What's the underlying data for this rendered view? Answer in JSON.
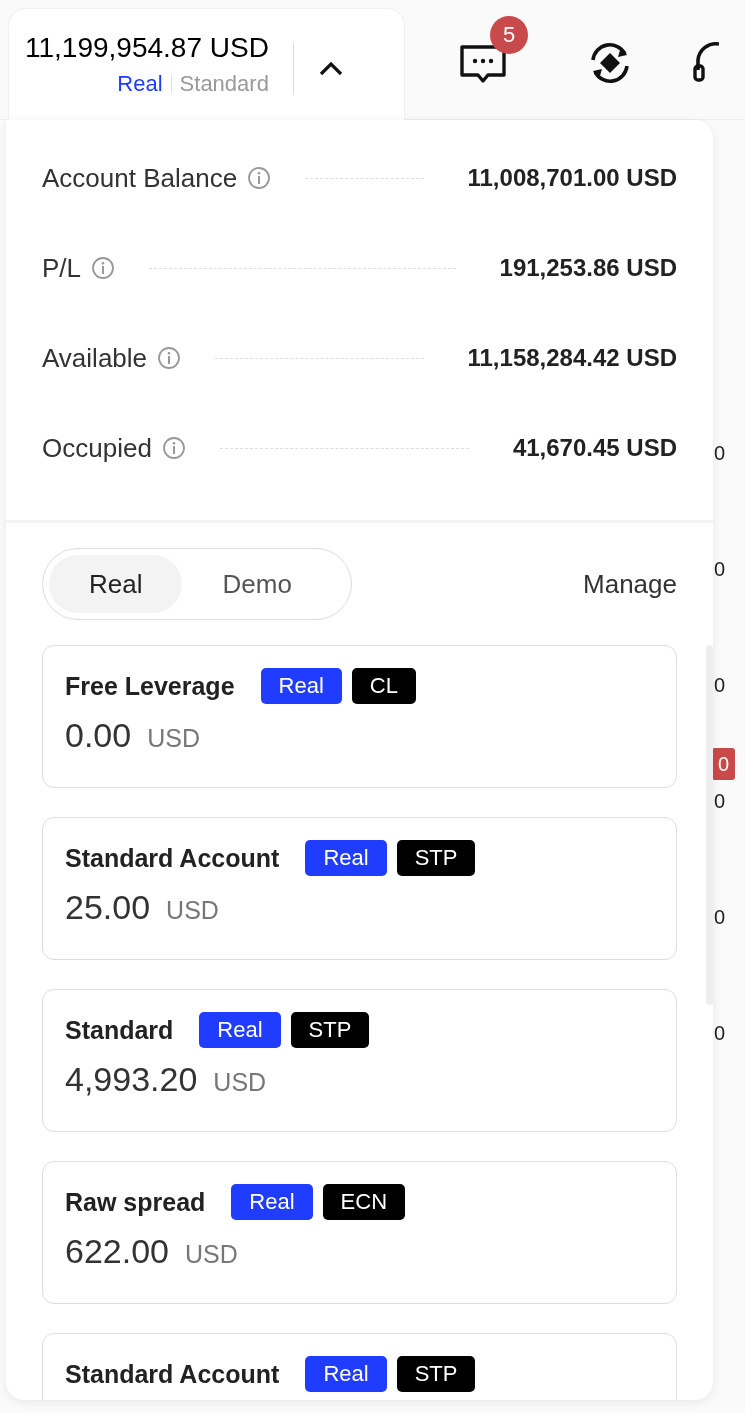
{
  "header": {
    "balance": "11,199,954.87 USD",
    "account_type": "Real",
    "account_name": "Standard",
    "expanded": true
  },
  "notifications": {
    "count": "5"
  },
  "summary": [
    {
      "label": "Account Balance",
      "value": "11,008,701.00 USD"
    },
    {
      "label": "P/L",
      "value": "191,253.86 USD"
    },
    {
      "label": "Available",
      "value": "11,158,284.42 USD"
    },
    {
      "label": "Occupied",
      "value": "41,670.45 USD"
    }
  ],
  "account_tabs": [
    {
      "label": "Real",
      "selected": true
    },
    {
      "label": "Demo",
      "selected": false
    }
  ],
  "manage": "Manage",
  "accounts": [
    {
      "name": "Free Leverage",
      "tags": [
        {
          "label": "Real",
          "kind": "mode"
        },
        {
          "label": "CL",
          "kind": "type"
        }
      ],
      "amount": "0.00",
      "currency": "USD"
    },
    {
      "name": "Standard Account",
      "tags": [
        {
          "label": "Real",
          "kind": "mode"
        },
        {
          "label": "STP",
          "kind": "type"
        }
      ],
      "amount": "25.00",
      "currency": "USD"
    },
    {
      "name": "Standard",
      "tags": [
        {
          "label": "Real",
          "kind": "mode"
        },
        {
          "label": "STP",
          "kind": "type"
        }
      ],
      "amount": "4,993.20",
      "currency": "USD"
    },
    {
      "name": "Raw spread",
      "tags": [
        {
          "label": "Real",
          "kind": "mode"
        },
        {
          "label": "ECN",
          "kind": "type"
        }
      ],
      "amount": "622.00",
      "currency": "USD"
    },
    {
      "name": "Standard Account",
      "tags": [
        {
          "label": "Real",
          "kind": "mode"
        },
        {
          "label": "STP",
          "kind": "type"
        }
      ]
    }
  ],
  "background_cells": [
    {
      "text": "0",
      "kind": "plain"
    },
    {
      "text": "0",
      "kind": "plain"
    },
    {
      "text": "0",
      "kind": "plain"
    },
    {
      "text": "0",
      "kind": "badge"
    },
    {
      "text": "0",
      "kind": "plain"
    },
    {
      "text": "0",
      "kind": "plain"
    },
    {
      "text": "0",
      "kind": "plain"
    }
  ]
}
